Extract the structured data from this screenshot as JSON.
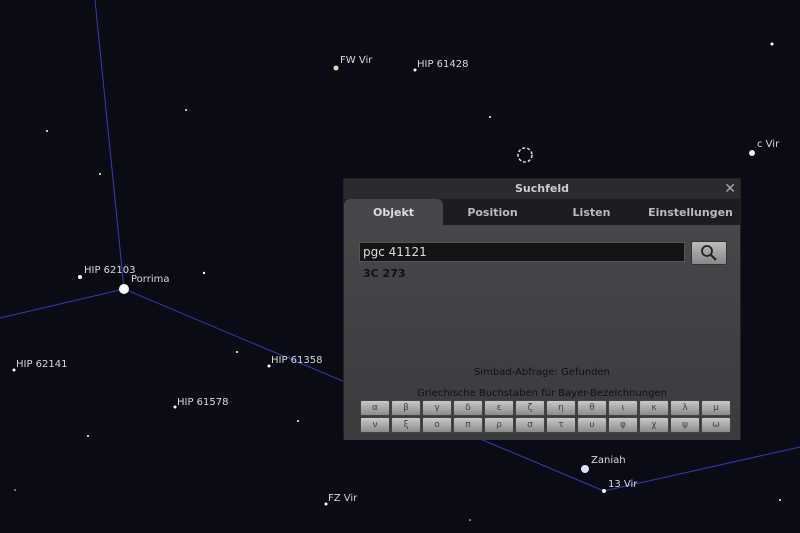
{
  "sky": {
    "labels": [
      "FW Vir",
      "HIP 61428",
      "c Vir",
      "HIP 62103",
      "Porrima",
      "HIP 62141",
      "HIP 61358",
      "HIP 61578",
      "Zaniah",
      "13 Vir",
      "FZ Vir"
    ]
  },
  "dialog": {
    "title": "Suchfeld",
    "close": "✕",
    "tabs": [
      "Objekt",
      "Position",
      "Listen",
      "Einstellungen"
    ],
    "search_value": "pgc 41121",
    "search_icon": "search-icon",
    "result": "3C 273",
    "simbad_status": "Simbad-Abfrage: Gefunden",
    "greek_label": "Griechische Buchstaben für Bayer-Bezeichnungen",
    "greek": [
      "α",
      "β",
      "γ",
      "δ",
      "ε",
      "ζ",
      "η",
      "θ",
      "ι",
      "κ",
      "λ",
      "μ",
      "ν",
      "ξ",
      "ο",
      "π",
      "ρ",
      "σ",
      "τ",
      "υ",
      "φ",
      "χ",
      "ψ",
      "ω"
    ]
  }
}
